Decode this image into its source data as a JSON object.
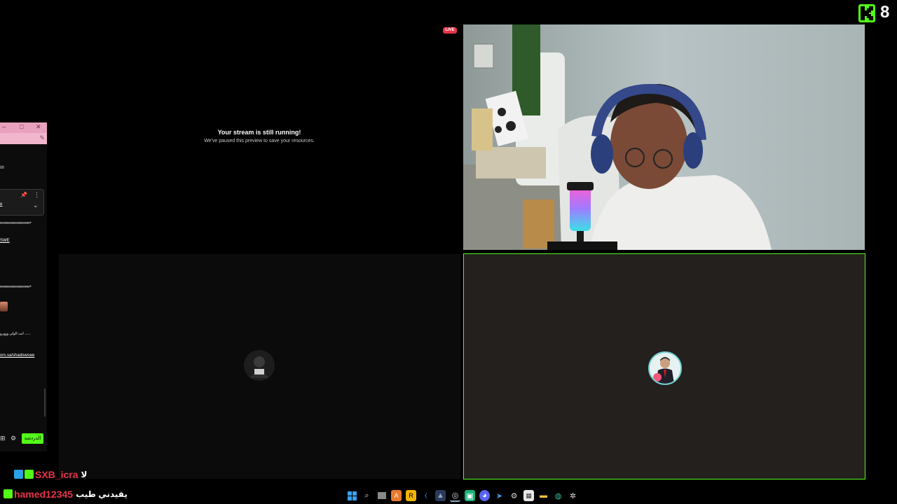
{
  "kick": {
    "viewer_count": "8",
    "brand_color": "#53fc18"
  },
  "chat_window": {
    "title_controls": [
      "–",
      "□",
      "✕"
    ],
    "top_text": "ith",
    "pinned_text": "e",
    "lines": [
      {
        "text": "ᵃᵃᵃᵃᵃᵃᵃᵃᵃᵃᵃᵃᵃᵃᵃᵃᵃᵃᵃ*",
        "underline": false
      },
      {
        "text": "SWE",
        "underline": true
      },
      {
        "text": "ᵃᵃᵃᵃᵃᵃᵃᵃᵃᵃᵃᵃᵃᵃᵃᵃᵃᵃᵃ*",
        "underline": false
      },
      {
        "text": "انت الولي ووورو ......",
        "underline": false
      },
      {
        "text": "ors.sa/shadowswe",
        "underline": true
      }
    ],
    "send_label": "الدردشة"
  },
  "preview": {
    "title": "Your stream is still running!",
    "subtitle": "We've paused this preview to save your resources."
  },
  "live_badge": "LIVE",
  "overlay_chat": [
    {
      "user": "SXB_icra",
      "message": "لا",
      "user_color": "#e8334a"
    },
    {
      "user": "hamed12345",
      "message": "يقيدني طيب",
      "user_color": "#e8334a"
    }
  ],
  "taskbar": {
    "icons": [
      "windows-start-icon",
      "search-icon",
      "task-view-icon",
      "app-orange-icon",
      "app-yellow-icon",
      "vscode-icon",
      "app-dark-icon",
      "obs-icon",
      "app-green-icon",
      "discord-icon",
      "app-blue-icon",
      "steam-icon",
      "calendar-icon",
      "file-explorer-icon",
      "edge-icon",
      "settings-icon"
    ]
  }
}
